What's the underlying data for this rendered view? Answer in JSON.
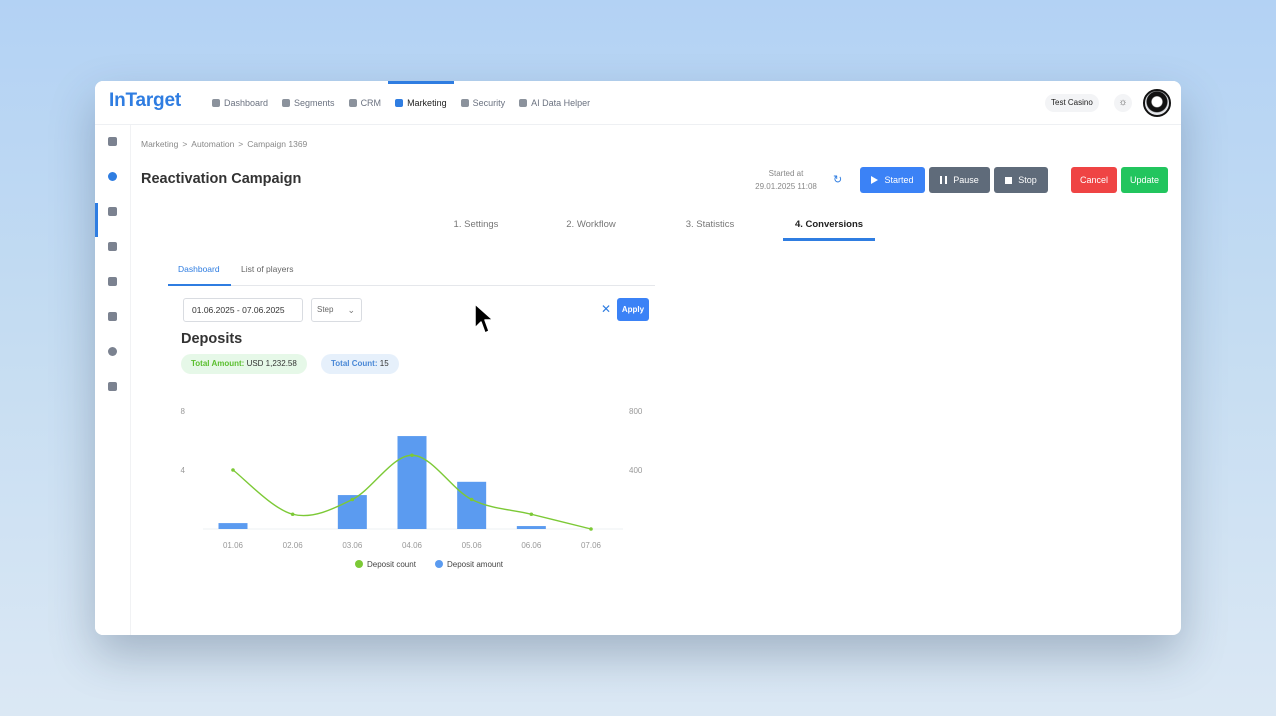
{
  "app": {
    "logo": "InTarget"
  },
  "nav": [
    {
      "label": "Dashboard",
      "icon": "pie-icon"
    },
    {
      "label": "Segments",
      "icon": "table-icon"
    },
    {
      "label": "CRM",
      "icon": "users-icon"
    },
    {
      "label": "Marketing",
      "icon": "mail-icon",
      "active": true
    },
    {
      "label": "Security",
      "icon": "key-icon"
    },
    {
      "label": "AI Data Helper",
      "icon": "sparkle-icon"
    }
  ],
  "header": {
    "tenant": "Test Casino",
    "theme_icon": "sun-icon",
    "avatar": "panda-avatar"
  },
  "rail_icons": [
    "pie-icon",
    "dashboard-icon",
    "grid-icon",
    "chat-icon",
    "device-icon",
    "bell-icon",
    "globe-icon",
    "archive-icon"
  ],
  "breadcrumb": [
    "Marketing",
    "Automation",
    "Campaign 1369"
  ],
  "breadcrumb_sep": ">",
  "campaign": {
    "title": "Reactivation Campaign",
    "started_label": "Started at",
    "started_at": "29.01.2025 11:08"
  },
  "buttons": {
    "started": "Started",
    "pause": "Pause",
    "stop": "Stop",
    "cancel": "Cancel",
    "update": "Update"
  },
  "steps": [
    "1. Settings",
    "2. Workflow",
    "3. Statistics",
    "4. Conversions"
  ],
  "active_step": 3,
  "subtabs": [
    "Dashboard",
    "List of players"
  ],
  "filters": {
    "date_range": "01.06.2025 - 07.06.2025",
    "step_placeholder": "Step",
    "apply": "Apply"
  },
  "section_title": "Deposits",
  "stats": {
    "amount_label": "Total Amount:",
    "amount_value": "USD 1,232.58",
    "count_label": "Total Count:",
    "count_value": "15"
  },
  "colors": {
    "accent": "#2f7de1",
    "count_line": "#7cc936",
    "amount_bar": "#5b9bf0",
    "danger": "#ef4444",
    "success": "#22c55e",
    "neutral": "#5f6b7a"
  },
  "chart_data": {
    "type": "bar",
    "categories": [
      "01.06",
      "02.06",
      "03.06",
      "04.06",
      "05.06",
      "06.06",
      "07.06"
    ],
    "series": [
      {
        "name": "Deposit count",
        "type": "line",
        "axis": "left",
        "values": [
          4,
          1,
          2,
          5,
          2,
          1,
          0
        ]
      },
      {
        "name": "Deposit amount",
        "type": "bar",
        "axis": "right",
        "values": [
          40,
          0,
          230,
          630,
          320,
          20,
          0
        ]
      }
    ],
    "y_left": {
      "ticks": [
        "8",
        "4"
      ],
      "range": [
        0,
        8
      ]
    },
    "y_right": {
      "ticks": [
        "800",
        "400"
      ],
      "range": [
        0,
        800
      ]
    },
    "legend": [
      "Deposit count",
      "Deposit amount"
    ],
    "legend_position": "bottom"
  }
}
